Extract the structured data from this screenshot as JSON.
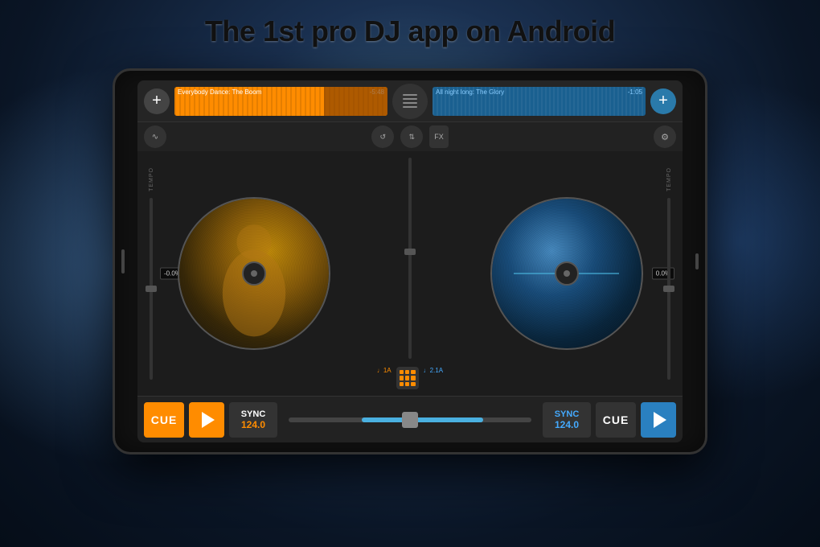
{
  "title": "The 1st pro DJ app on Android",
  "app": {
    "left_track": {
      "name": "Everybody Dance: The Boom",
      "time": "-5:48",
      "bpm": "124.0",
      "pitch": "-0.0%",
      "key": "♩1A"
    },
    "right_track": {
      "name": "All night long: The Glory",
      "time": "-1:05",
      "bpm": "124.0",
      "pitch": "0.0%",
      "key": "♩2.1A"
    },
    "controls": {
      "cue_left": "CUE",
      "play_left": "▶",
      "sync_left": "SYNC",
      "sync_right": "SYNC",
      "cue_right": "CUE",
      "play_right": "▶",
      "fx_label": "FX",
      "tempo_label": "TEMPO"
    }
  }
}
